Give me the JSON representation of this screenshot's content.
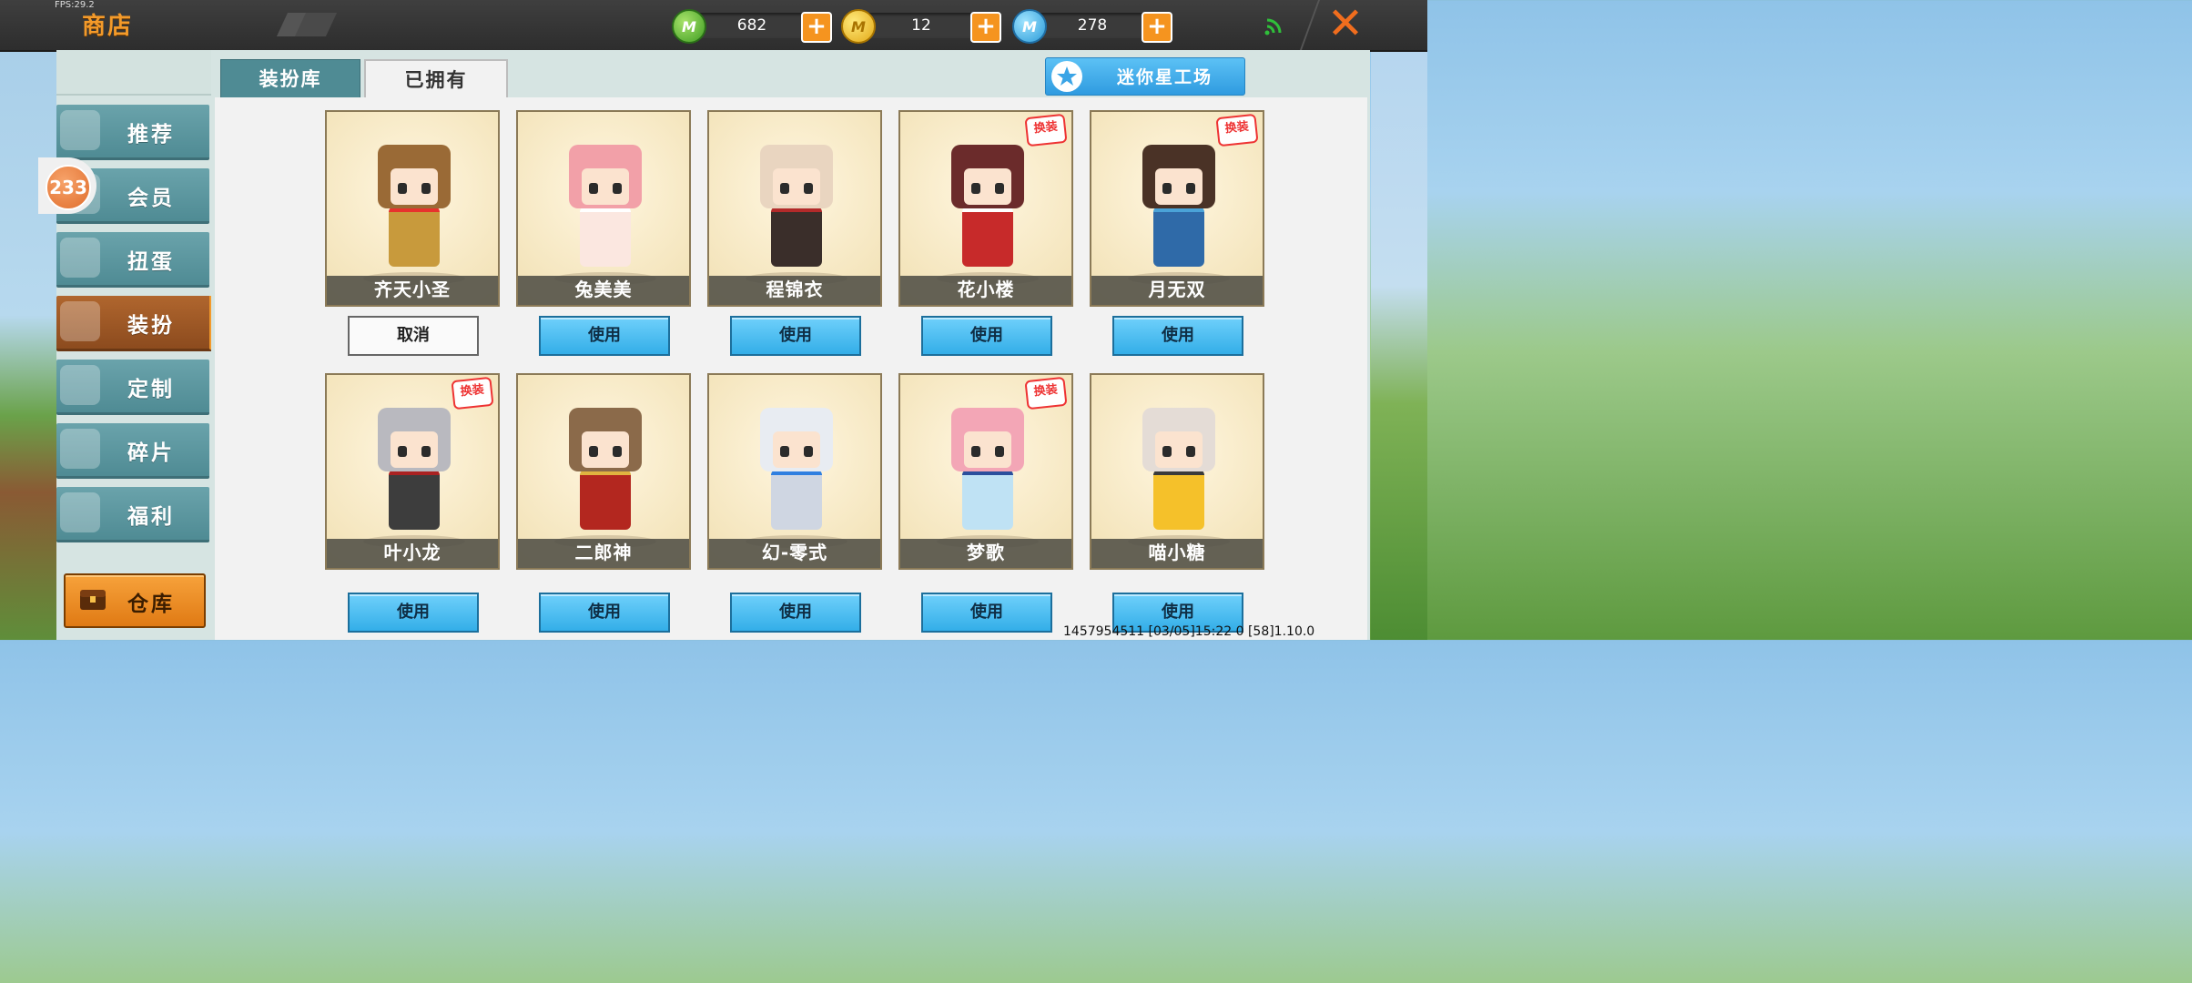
{
  "fps": "FPS:29.2",
  "header": {
    "title": "商店",
    "currencies": [
      {
        "name": "green-coin",
        "symbol": "M",
        "value": "682",
        "color": "#5cb434"
      },
      {
        "name": "gold-coin",
        "symbol": "M",
        "value": "12",
        "color": "#e2a817"
      },
      {
        "name": "blue-coin",
        "symbol": "M",
        "value": "278",
        "color": "#2a9ad8"
      }
    ],
    "plus_glyph": "+",
    "close_glyph": "✕"
  },
  "sidebar": {
    "badge": "233",
    "items": [
      {
        "label": "推荐",
        "icon": "thumbs-up-icon"
      },
      {
        "label": "会员",
        "icon": "vip-icon"
      },
      {
        "label": "扭蛋",
        "icon": "capsule-icon"
      },
      {
        "label": "装扮",
        "icon": "shirt-icon",
        "active": true
      },
      {
        "label": "定制",
        "icon": "pencil-icon"
      },
      {
        "label": "碎片",
        "icon": "puzzle-icon"
      },
      {
        "label": "福利",
        "icon": "gift-icon"
      }
    ],
    "warehouse_label": "仓库"
  },
  "tabs": {
    "library": "装扮库",
    "owned": "已拥有"
  },
  "studio_label": "迷你星工场",
  "swap_tag": "换装",
  "skins": [
    {
      "name": "齐天小圣",
      "action": "取消",
      "swap": false,
      "head": "#9a6a36",
      "body": "#c89a3c",
      "accent": "#e7322d"
    },
    {
      "name": "兔美美",
      "action": "使用",
      "swap": false,
      "head": "#f2a0a8",
      "body": "#fbe7e0",
      "accent": "#ffffff"
    },
    {
      "name": "程锦衣",
      "action": "使用",
      "swap": false,
      "head": "#e9d5c0",
      "body": "#3a2e2a",
      "accent": "#b32a2a"
    },
    {
      "name": "花小楼",
      "action": "使用",
      "swap": true,
      "head": "#6b2b2b",
      "body": "#c72a2a",
      "accent": "#ffffff"
    },
    {
      "name": "月无双",
      "action": "使用",
      "swap": true,
      "head": "#4a3226",
      "body": "#2f6aa8",
      "accent": "#4aa3d8"
    },
    {
      "name": "叶小龙",
      "action": "使用",
      "swap": true,
      "head": "#b9b9bf",
      "body": "#3d3d3d",
      "accent": "#a22"
    },
    {
      "name": "二郎神",
      "action": "使用",
      "swap": false,
      "head": "#8b6a4a",
      "body": "#b3271f",
      "accent": "#e0b440"
    },
    {
      "name": "幻-零式",
      "action": "使用",
      "swap": false,
      "head": "#e8ecf2",
      "body": "#cfd6e2",
      "accent": "#2f7fe0"
    },
    {
      "name": "梦歌",
      "action": "使用",
      "swap": true,
      "head": "#f3a6b6",
      "body": "#bfe2f4",
      "accent": "#2b4f9c"
    },
    {
      "name": "喵小糖",
      "action": "使用",
      "swap": false,
      "head": "#e4dcd6",
      "body": "#f5c12a",
      "accent": "#3a3a3a"
    }
  ],
  "footer": "1457954511    [03/05]15:22 0  [58]1.10.0"
}
